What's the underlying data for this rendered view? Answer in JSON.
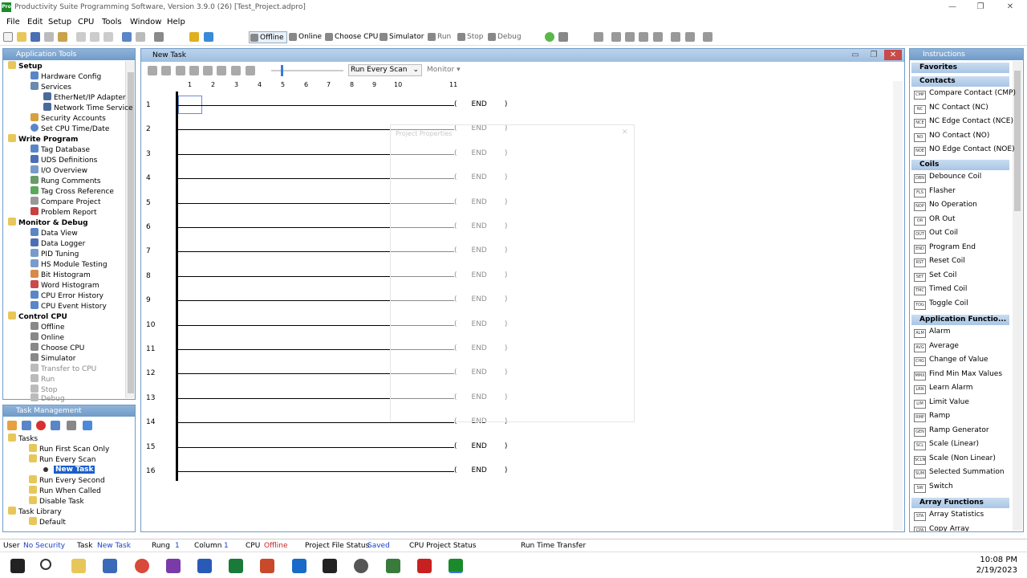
{
  "window": {
    "title": "Productivity Suite Programming Software, Version 3.9.0 (26)  [Test_Project.adpro]",
    "logo_text": "Pro",
    "minimize": "—",
    "maximize": "❐",
    "close": "✕"
  },
  "menu": [
    "File",
    "Edit",
    "Setup",
    "CPU",
    "Tools",
    "Window",
    "Help"
  ],
  "toolbar": {
    "offline": "Offline",
    "online": "Online",
    "choose_cpu": "Choose CPU",
    "simulator": "Simulator",
    "run": "Run",
    "stop": "Stop",
    "debug": "Debug"
  },
  "app_tools": {
    "title": "Application Tools",
    "setup": "Setup",
    "hardware_config": "Hardware Config",
    "services": "Services",
    "ethernet_ip_adapter": "EtherNet/IP Adapter",
    "network_time_service": "Network Time Service",
    "security_accounts": "Security Accounts",
    "set_cpu_time": "Set CPU Time/Date",
    "write_program": "Write Program",
    "tag_database": "Tag Database",
    "uds_definitions": "UDS Definitions",
    "io_overview": "I/O Overview",
    "rung_comments": "Rung Comments",
    "tag_cross_reference": "Tag Cross Reference",
    "compare_project": "Compare Project",
    "problem_report": "Problem Report",
    "monitor_debug": "Monitor & Debug",
    "data_view": "Data View",
    "data_logger": "Data Logger",
    "pid_tuning": "PID Tuning",
    "hs_module_testing": "HS Module Testing",
    "bit_histogram": "Bit Histogram",
    "word_histogram": "Word Histogram",
    "cpu_error_history": "CPU Error History",
    "cpu_event_history": "CPU Event History",
    "control_cpu": "Control CPU",
    "offline": "Offline",
    "online": "Online",
    "choose_cpu": "Choose CPU",
    "simulator": "Simulator",
    "transfer_to_cpu": "Transfer to CPU",
    "run": "Run",
    "stop": "Stop",
    "debug": "Debug"
  },
  "task_mgmt": {
    "title": "Task Management",
    "tasks": "Tasks",
    "run_first_scan_only": "Run First Scan Only",
    "run_every_scan": "Run Every Scan",
    "new_task": "New Task",
    "run_every_second": "Run Every Second",
    "run_when_called": "Run When Called",
    "disable_task": "Disable Task",
    "task_library": "Task Library",
    "default": "Default"
  },
  "editor": {
    "title": "New Task",
    "scan_select": "Run Every Scan",
    "monitor": "Monitor",
    "columns": [
      "1",
      "2",
      "3",
      "4",
      "5",
      "6",
      "7",
      "8",
      "9",
      "10",
      "11"
    ],
    "rungs": [
      "1",
      "2",
      "3",
      "4",
      "5",
      "6",
      "7",
      "8",
      "9",
      "10",
      "11",
      "12",
      "13",
      "14",
      "15",
      "16"
    ],
    "coil_open": "(",
    "coil_label": "END",
    "coil_close": ")",
    "ghost_dialog_title": "Project Properties"
  },
  "instructions": {
    "title": "Instructions",
    "favorites": "Favorites",
    "contacts": "Contacts",
    "contact_items": [
      {
        "icon": "CMP",
        "label": "Compare Contact  (CMP)"
      },
      {
        "icon": "NC",
        "label": "NC Contact  (NC)"
      },
      {
        "icon": "NCE",
        "label": "NC Edge Contact  (NCE)"
      },
      {
        "icon": "NO",
        "label": "NO Contact  (NO)"
      },
      {
        "icon": "NOE",
        "label": "NO Edge Contact  (NOE)"
      }
    ],
    "coils": "Coils",
    "coil_items": [
      {
        "icon": "DBN",
        "label": "Debounce Coil"
      },
      {
        "icon": "FLS",
        "label": "Flasher"
      },
      {
        "icon": "NOP",
        "label": "No Operation"
      },
      {
        "icon": "OR",
        "label": "OR Out"
      },
      {
        "icon": "OUT",
        "label": "Out Coil"
      },
      {
        "icon": "END",
        "label": "Program End"
      },
      {
        "icon": "RST",
        "label": "Reset Coil"
      },
      {
        "icon": "SET",
        "label": "Set Coil"
      },
      {
        "icon": "TMC",
        "label": "Timed Coil"
      },
      {
        "icon": "TOG",
        "label": "Toggle Coil"
      }
    ],
    "app_functions": "Application Functio...",
    "app_items": [
      {
        "icon": "ALM",
        "label": "Alarm"
      },
      {
        "icon": "AVG",
        "label": "Average"
      },
      {
        "icon": "CHG",
        "label": "Change of Value"
      },
      {
        "icon": "MMX",
        "label": "Find Min Max Values"
      },
      {
        "icon": "LRN",
        "label": "Learn Alarm"
      },
      {
        "icon": "LIM",
        "label": "Limit Value"
      },
      {
        "icon": "RMP",
        "label": "Ramp"
      },
      {
        "icon": "GEN",
        "label": "Ramp Generator"
      },
      {
        "icon": "SCL",
        "label": "Scale (Linear)"
      },
      {
        "icon": "SCLN",
        "label": "Scale (Non Linear)"
      },
      {
        "icon": "SUM",
        "label": "Selected Summation"
      },
      {
        "icon": "SW",
        "label": "Switch"
      }
    ],
    "array_functions": "Array Functions",
    "array_items": [
      {
        "icon": "STA",
        "label": "Array Statistics"
      },
      {
        "icon": "CPA",
        "label": "Copy Array"
      }
    ]
  },
  "status": {
    "user_label": "User",
    "user_value": "No Security",
    "task_label": "Task",
    "task_value": "New Task",
    "rung_label": "Rung",
    "rung_value": "1",
    "column_label": "Column",
    "column_value": "1",
    "cpu_label": "CPU",
    "cpu_value": "Offline",
    "file_status_label": "Project File Status",
    "file_status_value": "Saved",
    "cpu_project_status": "CPU Project Status",
    "run_time_transfer": "Run Time Transfer"
  },
  "taskbar": {
    "time": "10:08 PM",
    "date": "2/19/2023"
  }
}
